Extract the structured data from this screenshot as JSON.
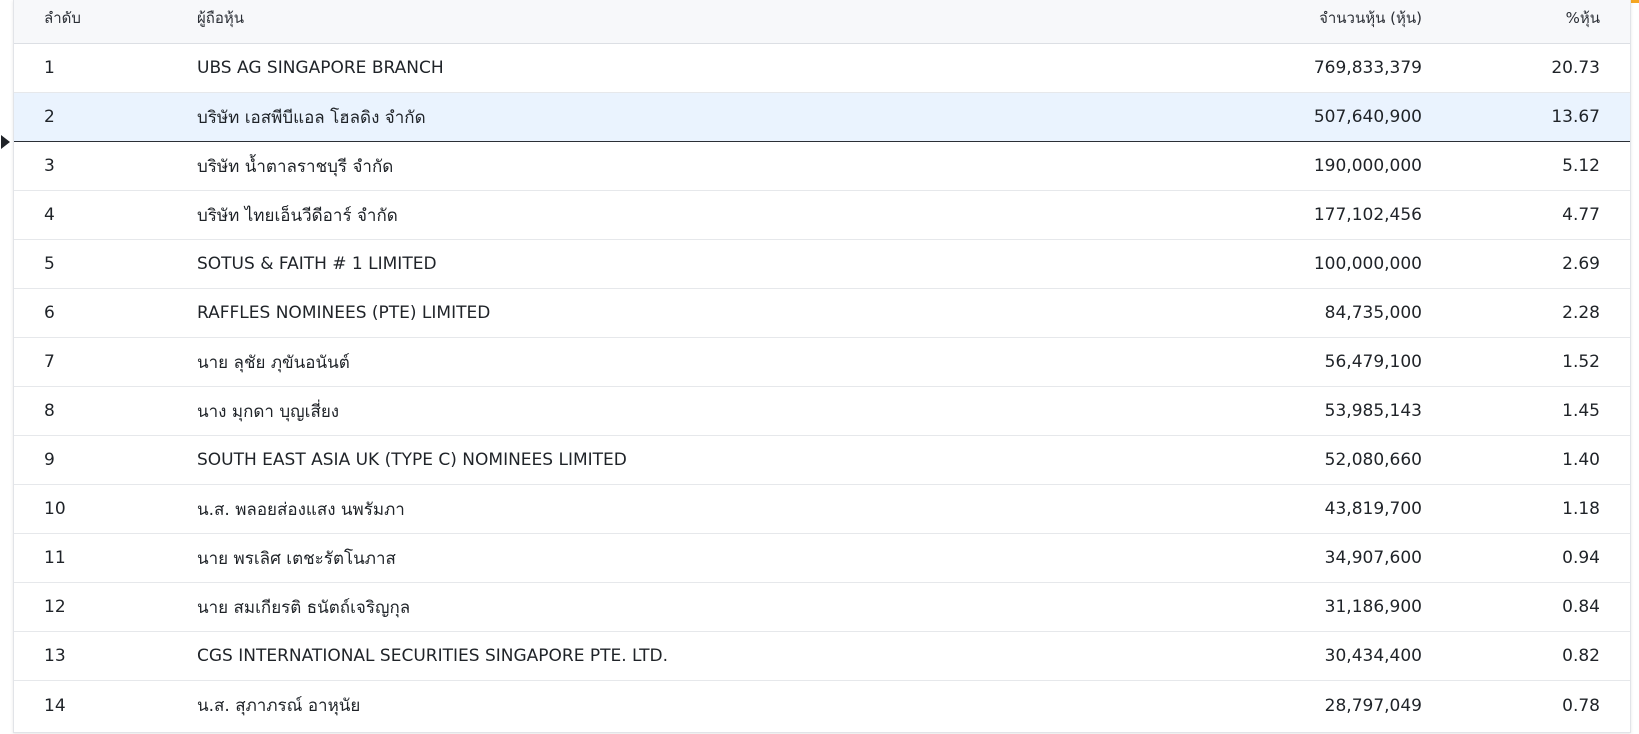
{
  "header": {
    "rank": "ลำดับ",
    "holder": "ผู้ถือหุ้น",
    "shares": "จำนวนหุ้น (หุ้น)",
    "percent": "%หุ้น"
  },
  "rows": [
    {
      "rank": "1",
      "name": "UBS AG SINGAPORE BRANCH",
      "shares": "769,833,379",
      "pct": "20.73"
    },
    {
      "rank": "2",
      "name": "บริษัท เอสพีบีแอล โฮลดิง จำกัด",
      "shares": "507,640,900",
      "pct": "13.67"
    },
    {
      "rank": "3",
      "name": "บริษัท น้ำตาลราชบุรี จำกัด",
      "shares": "190,000,000",
      "pct": "5.12"
    },
    {
      "rank": "4",
      "name": "บริษัท ไทยเอ็นวีดีอาร์ จำกัด",
      "shares": "177,102,456",
      "pct": "4.77"
    },
    {
      "rank": "5",
      "name": "SOTUS & FAITH # 1 LIMITED",
      "shares": "100,000,000",
      "pct": "2.69"
    },
    {
      "rank": "6",
      "name": "RAFFLES NOMINEES (PTE) LIMITED",
      "shares": "84,735,000",
      "pct": "2.28"
    },
    {
      "rank": "7",
      "name": "นาย ลุชัย ภุขันอนันต์",
      "shares": "56,479,100",
      "pct": "1.52"
    },
    {
      "rank": "8",
      "name": "นาง มุกดา บุญเสี่ยง",
      "shares": "53,985,143",
      "pct": "1.45"
    },
    {
      "rank": "9",
      "name": "SOUTH EAST ASIA UK (TYPE C) NOMINEES LIMITED",
      "shares": "52,080,660",
      "pct": "1.40"
    },
    {
      "rank": "10",
      "name": "น.ส. พลอยส่องแสง นพรัมภา",
      "shares": "43,819,700",
      "pct": "1.18"
    },
    {
      "rank": "11",
      "name": "นาย พรเลิศ เตชะรัตโนภาส",
      "shares": "34,907,600",
      "pct": "0.94"
    },
    {
      "rank": "12",
      "name": "นาย สมเกียรติ ธนัตถ์เจริญกุล",
      "shares": "31,186,900",
      "pct": "0.84"
    },
    {
      "rank": "13",
      "name": "CGS INTERNATIONAL SECURITIES SINGAPORE PTE. LTD.",
      "shares": "30,434,400",
      "pct": "0.82"
    },
    {
      "rank": "14",
      "name": "น.ส. สุภาภรณ์ อาหุนัย",
      "shares": "28,797,049",
      "pct": "0.78"
    }
  ],
  "colors": {
    "accent": "#f5a623",
    "selected_row": "#eaf3fe",
    "header_bg": "#f7f8fa"
  }
}
